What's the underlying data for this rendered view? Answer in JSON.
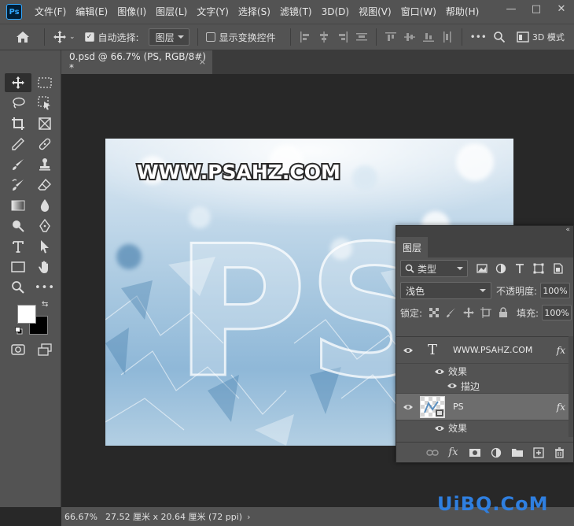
{
  "menubar": {
    "logo": "Ps",
    "items": [
      "文件(F)",
      "编辑(E)",
      "图像(I)",
      "图层(L)",
      "文字(Y)",
      "选择(S)",
      "滤镜(T)",
      "3D(D)",
      "视图(V)",
      "窗口(W)",
      "帮助(H)"
    ],
    "window_buttons": [
      "—",
      "□",
      "✕"
    ]
  },
  "options": {
    "auto_select_label": "自动选择:",
    "auto_select_checked": true,
    "auto_select_target": "图层",
    "transform_controls_label": "显示变换控件",
    "transform_controls_checked": false,
    "mode_3d_label": "3D 模式"
  },
  "document": {
    "tab_title": "0.psd @ 66.7% (PS, RGB/8#) *",
    "close": "×",
    "artwork_url_text": "WWW.PSAHZ.COM",
    "artwork_letters": "PS"
  },
  "toolbar": {
    "collapse": "«",
    "tools": [
      {
        "name": "move-tool",
        "icon": "move-icon"
      },
      {
        "name": "marquee-tool",
        "icon": "marquee-icon"
      },
      {
        "name": "lasso-tool",
        "icon": "lasso-icon"
      },
      {
        "name": "object-select-tool",
        "icon": "object-select-icon"
      },
      {
        "name": "crop-tool",
        "icon": "crop-icon"
      },
      {
        "name": "frame-tool",
        "icon": "frame-icon"
      },
      {
        "name": "eyedropper-tool",
        "icon": "eyedropper-icon"
      },
      {
        "name": "healing-tool",
        "icon": "healing-icon"
      },
      {
        "name": "brush-tool",
        "icon": "brush-icon"
      },
      {
        "name": "stamp-tool",
        "icon": "stamp-icon"
      },
      {
        "name": "history-brush-tool",
        "icon": "history-brush-icon"
      },
      {
        "name": "eraser-tool",
        "icon": "eraser-icon"
      },
      {
        "name": "gradient-tool",
        "icon": "gradient-icon"
      },
      {
        "name": "blur-tool",
        "icon": "blur-icon"
      },
      {
        "name": "dodge-tool",
        "icon": "dodge-icon"
      },
      {
        "name": "pen-tool",
        "icon": "pen-icon"
      },
      {
        "name": "type-tool",
        "icon": "type-icon"
      },
      {
        "name": "path-select-tool",
        "icon": "path-select-icon"
      },
      {
        "name": "rectangle-tool",
        "icon": "rectangle-icon"
      },
      {
        "name": "hand-tool",
        "icon": "hand-icon"
      },
      {
        "name": "zoom-tool",
        "icon": "zoom-icon"
      },
      {
        "name": "more-tools",
        "icon": "more-icon"
      }
    ],
    "foreground_color": "#ffffff",
    "background_color": "#000000"
  },
  "status": {
    "zoom": "66.67%",
    "doc_info": "27.52 厘米 x 20.64 厘米 (72 ppi)",
    "arrow": "›"
  },
  "watermark": "UiBQ.CoM",
  "layers_panel": {
    "collapse": "«",
    "tab": "图层",
    "kind_filter": "类型",
    "blend_mode": "浅色",
    "opacity_label": "不透明度:",
    "opacity": "100%",
    "lock_label": "锁定:",
    "fill_label": "填充:",
    "fill": "100%",
    "layers": [
      {
        "name": "WWW.PSAHZ.COM",
        "type": "text",
        "fx": "fx",
        "effects_label": "效果",
        "effects": [
          "描边"
        ]
      },
      {
        "name": "PS",
        "type": "pixel",
        "fx": "fx",
        "effects_label": "效果",
        "effects": []
      }
    ]
  }
}
